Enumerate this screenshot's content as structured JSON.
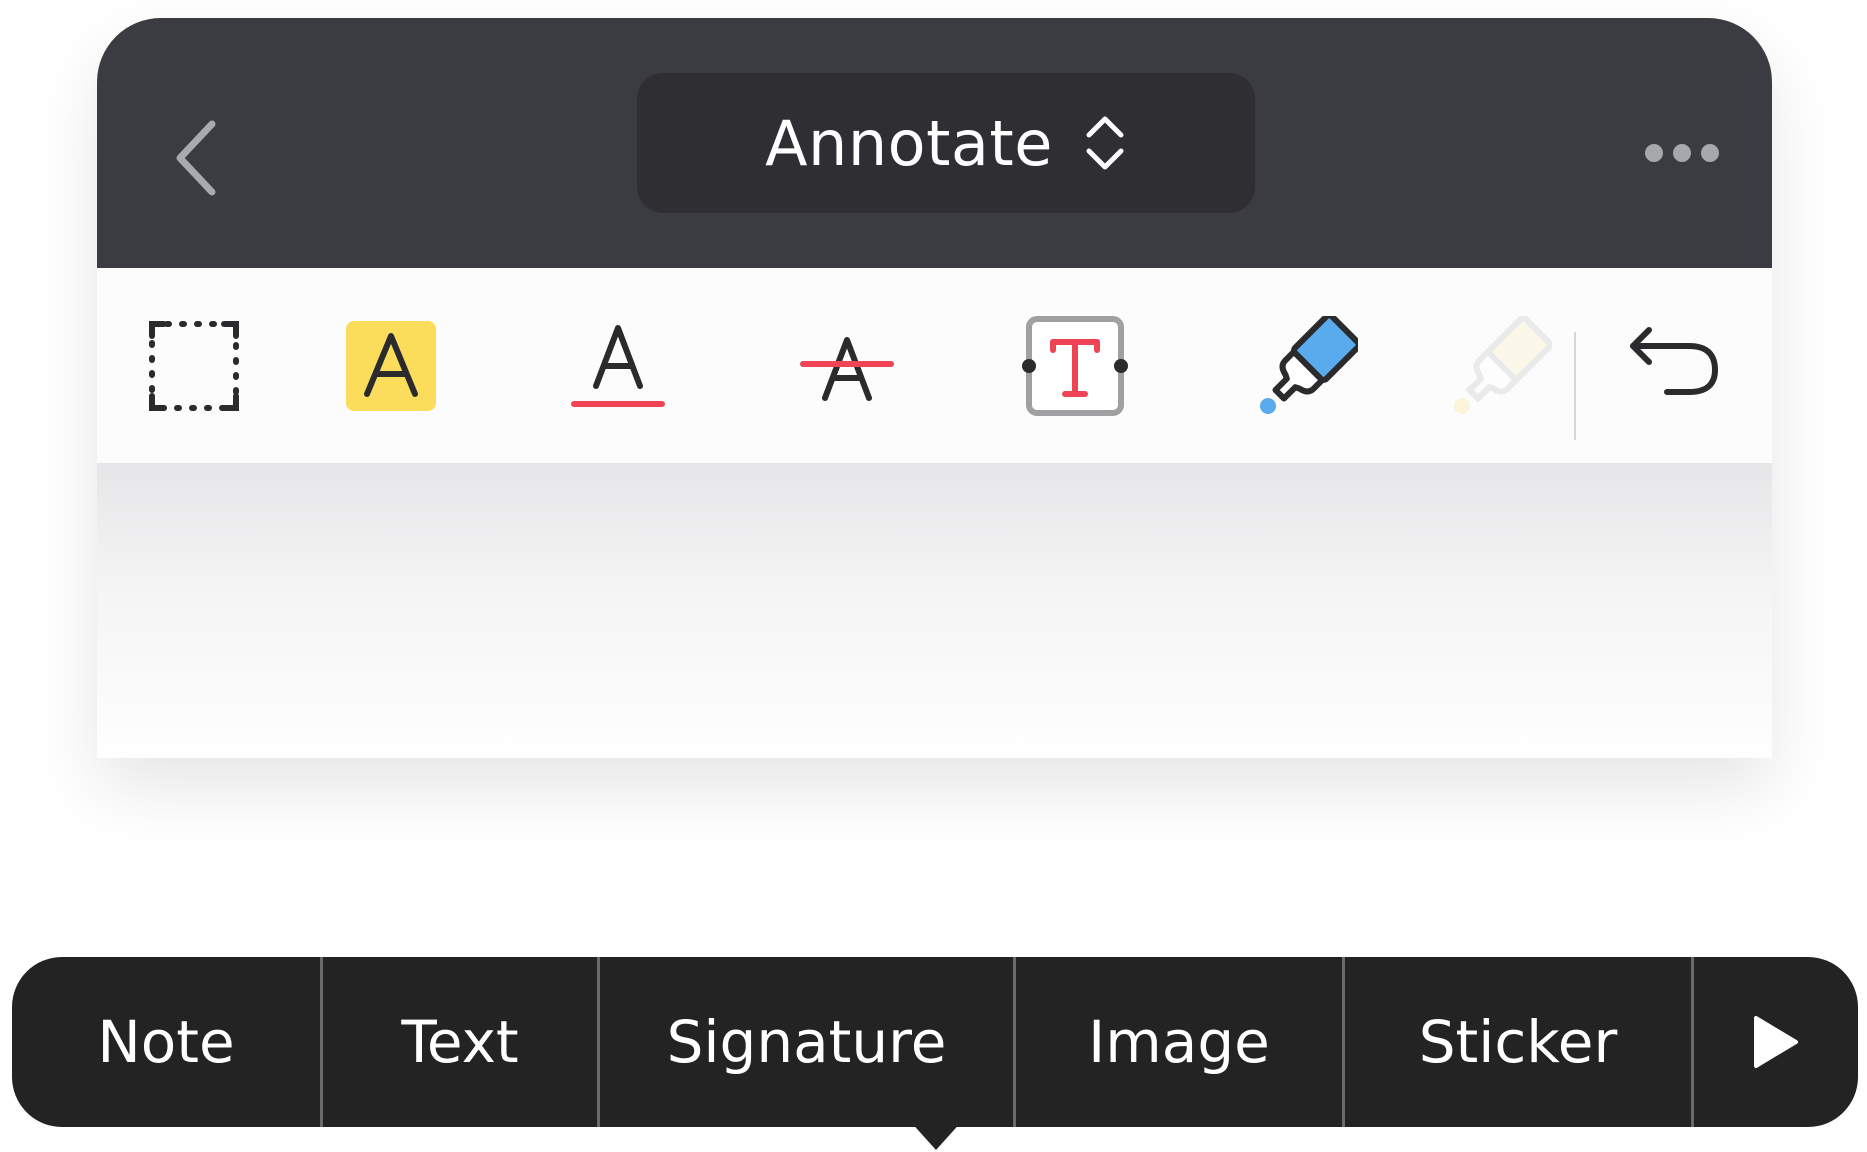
{
  "header": {
    "mode_label": "Annotate"
  },
  "toolbar": {
    "tools": [
      {
        "name": "select-area"
      },
      {
        "name": "highlight-text"
      },
      {
        "name": "underline-text"
      },
      {
        "name": "strikethrough-text"
      },
      {
        "name": "text-box"
      },
      {
        "name": "highlighter-pen"
      },
      {
        "name": "eraser"
      },
      {
        "name": "undo"
      }
    ],
    "highlight_letter": "A",
    "underline_letter": "A",
    "strike_letter": "A",
    "textbox_letter": "T"
  },
  "context_menu": {
    "items": [
      "Note",
      "Text",
      "Signature",
      "Image",
      "Sticker"
    ],
    "more_icon": "play-triangle-icon"
  },
  "colors": {
    "topbar": "#3b3c41",
    "mode_selector": "#2e2e33",
    "highlight_yellow": "#fbdd5b",
    "accent_red": "#ee4455",
    "highlighter_blue": "#5aabee",
    "menu_bg": "#232323"
  }
}
